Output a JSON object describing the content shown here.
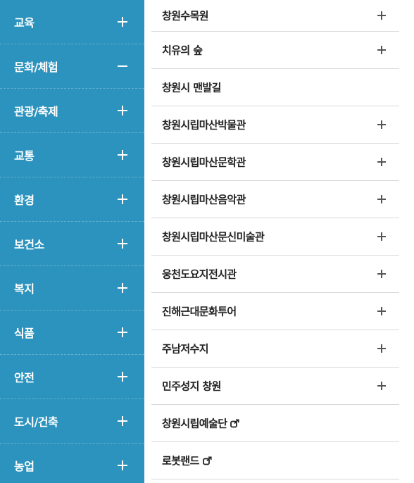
{
  "left_menu": {
    "items": [
      {
        "label": "교육",
        "state": "plus"
      },
      {
        "label": "문화/체험",
        "state": "minus"
      },
      {
        "label": "관광/축제",
        "state": "plus"
      },
      {
        "label": "교통",
        "state": "plus"
      },
      {
        "label": "환경",
        "state": "plus"
      },
      {
        "label": "보건소",
        "state": "plus"
      },
      {
        "label": "복지",
        "state": "plus"
      },
      {
        "label": "식품",
        "state": "plus"
      },
      {
        "label": "안전",
        "state": "plus"
      },
      {
        "label": "도시/건축",
        "state": "plus"
      },
      {
        "label": "농업",
        "state": "plus"
      }
    ],
    "bg_color": "#2b93bd"
  },
  "sub_menu": {
    "items": [
      {
        "label": "창원수목원",
        "icon": "plus-icon"
      },
      {
        "label": "치유의 숲",
        "icon": "plus-icon"
      },
      {
        "label": "창원시 맨발길",
        "icon": ""
      },
      {
        "label": "창원시립마산박물관",
        "icon": "plus-icon"
      },
      {
        "label": "창원시립마산문학관",
        "icon": "plus-icon"
      },
      {
        "label": "창원시립마산음악관",
        "icon": "plus-icon"
      },
      {
        "label": "창원시립마산문신미술관",
        "icon": "plus-icon"
      },
      {
        "label": "웅천도요지전시관",
        "icon": "plus-icon"
      },
      {
        "label": "진해근대문화투어",
        "icon": "plus-icon"
      },
      {
        "label": "주남저수지",
        "icon": "plus-icon"
      },
      {
        "label": "민주성지 창원",
        "icon": "plus-icon"
      },
      {
        "label": "창원시립예술단",
        "icon": "external-link-icon"
      },
      {
        "label": "로봇랜드",
        "icon": "external-link-icon"
      }
    ]
  }
}
